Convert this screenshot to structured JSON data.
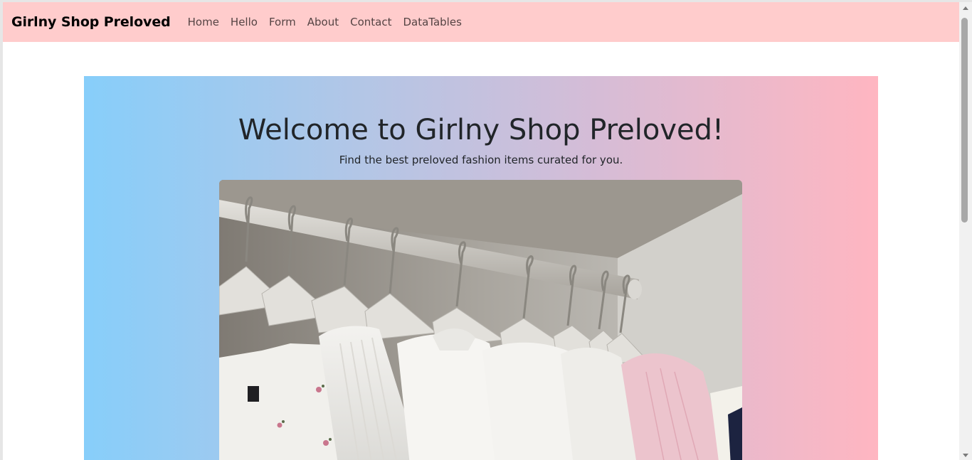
{
  "navbar": {
    "brand": "Girlny Shop Preloved",
    "links": [
      "Home",
      "Hello",
      "Form",
      "About",
      "Contact",
      "DataTables"
    ]
  },
  "hero": {
    "title": "Welcome to Girlny Shop Preloved!",
    "subtitle": "Find the best preloved fashion items curated for you.",
    "image_description": "clothes-on-hangers-photo"
  },
  "colors": {
    "navbar_bg": "#ffcccc",
    "gradient_start": "#87cefa",
    "gradient_end": "#ffb6c1"
  }
}
